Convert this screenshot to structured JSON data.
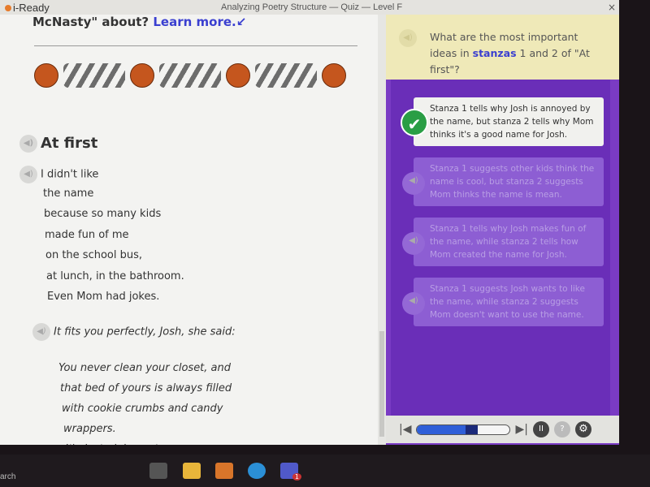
{
  "app": {
    "logo": "i-Ready",
    "window_title": "Analyzing Poetry Structure — Quiz — Level F",
    "close": "×"
  },
  "passage": {
    "prompt_tail": "McNasty\" about?",
    "learn_more": "Learn more.",
    "poem_title": "At first",
    "stanza1": [
      "I didn't like",
      "the name",
      "because so many kids",
      "made fun of me",
      "on the school bus,",
      "at lunch, in the bathroom.",
      "Even Mom had jokes."
    ],
    "stanza2": [
      "It fits you perfectly, Josh, she said:",
      "You never clean your closet, and",
      "that bed of yours is always filled",
      "with cookie crumbs and candy",
      "wrappers.",
      "It's just plain nasty, son."
    ]
  },
  "question": {
    "pre": "What are the most important ideas in",
    "highlight": "stanzas",
    "post": "1 and 2 of \"At first\"?"
  },
  "options": [
    {
      "text": "Stanza 1 tells why Josh is annoyed by the name, but stanza 2 tells why Mom thinks it's a good name for Josh.",
      "selected": true
    },
    {
      "text": "Stanza 1 suggests other kids think the name is cool, but stanza 2 suggests Mom thinks the name is mean.",
      "selected": false
    },
    {
      "text": "Stanza 1 tells why Josh makes fun of the name, while stanza 2 tells how Mom created the name for Josh.",
      "selected": false
    },
    {
      "text": "Stanza 1 suggests Josh wants to like the name, while stanza 2 suggests Mom doesn't want to use the name.",
      "selected": false
    }
  ],
  "controls": {
    "progress_percent": 52,
    "buffered_percent": 65,
    "pause": "II",
    "help": "?",
    "settings": "⚙"
  },
  "taskbar": {
    "search": "arch",
    "teams_badge": "1"
  },
  "colors": {
    "accent": "#7a3bc4",
    "correct": "#2a9e45",
    "link": "#3a3fd0"
  }
}
